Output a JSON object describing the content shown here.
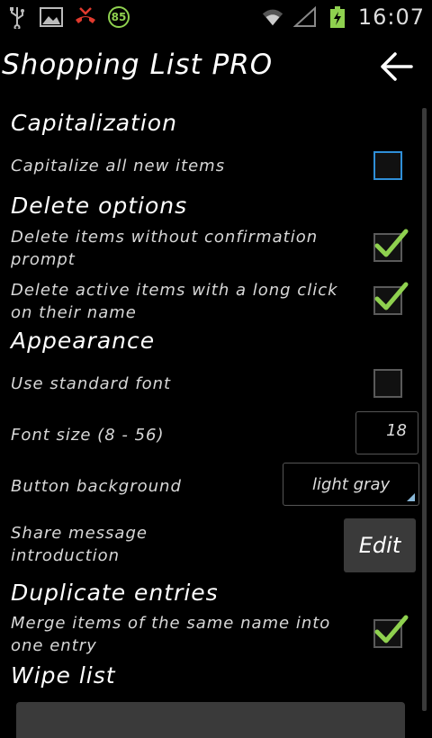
{
  "status_bar": {
    "battery_badge": "85",
    "time": "16:07"
  },
  "action_bar": {
    "title": "Shopping List PRO"
  },
  "sections": {
    "capitalization": "Capitalization",
    "delete_options": "Delete options",
    "appearance": "Appearance",
    "duplicate_entries": "Duplicate entries",
    "wipe_list": "Wipe list"
  },
  "settings": {
    "capitalize_all": {
      "label": "Capitalize all new items",
      "checked": false
    },
    "delete_no_confirm": {
      "label": "Delete items without confirmation prompt",
      "checked": true
    },
    "delete_long_click": {
      "label": "Delete active items with a long click on their name",
      "checked": true
    },
    "standard_font": {
      "label": "Use standard font",
      "checked": false
    },
    "font_size": {
      "label": "Font size (8 - 56)",
      "value": "18"
    },
    "button_background": {
      "label": "Button background",
      "value": "light gray"
    },
    "share_message": {
      "label": "Share message introduction",
      "button": "Edit"
    },
    "merge_items": {
      "label": "Merge items of the same name into one entry",
      "checked": true
    }
  },
  "colors": {
    "accent_check": "#8fd14f",
    "focus_border": "#2f8fd8"
  }
}
